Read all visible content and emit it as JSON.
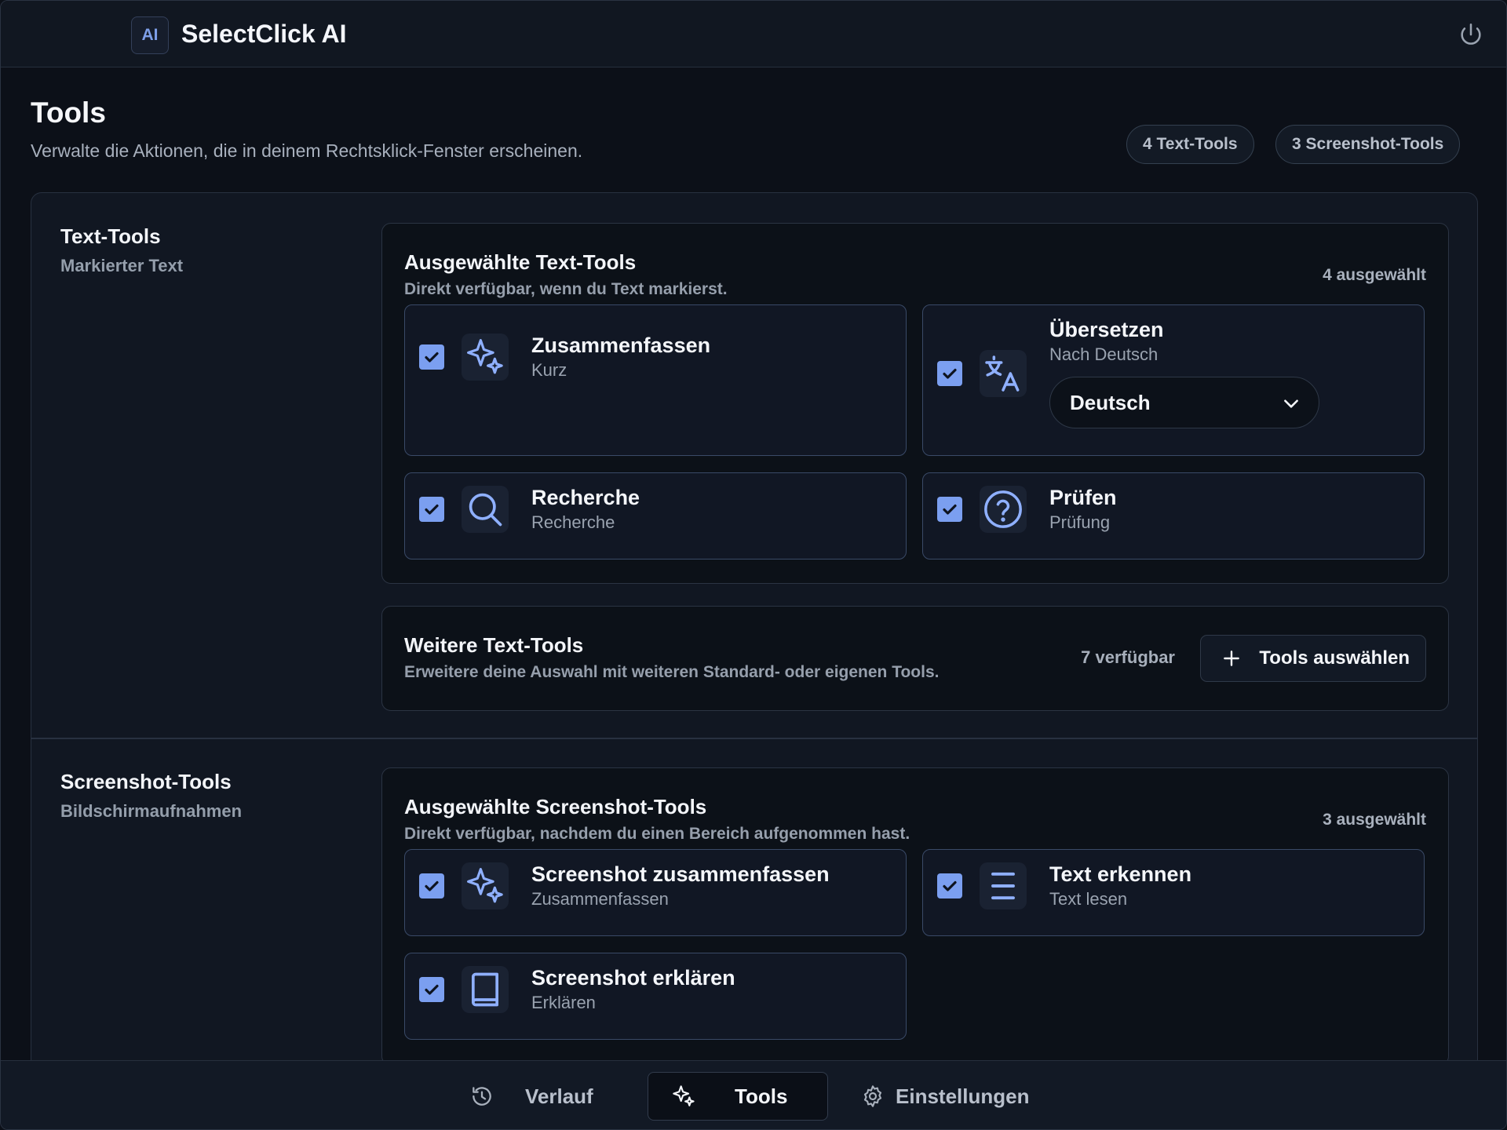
{
  "app": {
    "logo": "AI",
    "title": "SelectClick AI",
    "power_icon": "power-icon"
  },
  "page": {
    "title": "Tools",
    "subtitle": "Verwalte die Aktionen, die in deinem Rechtsklick-Fenster erscheinen.",
    "pills": {
      "text_tools": "4 Text-Tools",
      "screenshot_tools": "3 Screenshot-Tools"
    }
  },
  "text_section": {
    "title": "Text-Tools",
    "subtitle": "Markierter Text",
    "selected": {
      "title": "Ausgewählte Text-Tools",
      "description": "Direkt verfügbar, wenn du Text markierst.",
      "count": "4 ausgewählt",
      "tools": [
        {
          "name": "Zusammenfassen",
          "sub": "Kurz",
          "icon": "sparkles-icon",
          "checked": true
        },
        {
          "name": "Übersetzen",
          "sub": "Nach Deutsch",
          "icon": "translate-icon",
          "checked": true,
          "select_value": "Deutsch"
        },
        {
          "name": "Recherche",
          "sub": "Recherche",
          "icon": "search-icon",
          "checked": true
        },
        {
          "name": "Prüfen",
          "sub": "Prüfung",
          "icon": "question-circle-icon",
          "checked": true
        }
      ]
    },
    "more": {
      "title": "Weitere Text-Tools",
      "description": "Erweitere deine Auswahl mit weiteren Standard- oder eigenen Tools.",
      "available": "7 verfügbar",
      "button": "Tools auswählen"
    }
  },
  "screenshot_section": {
    "title": "Screenshot-Tools",
    "subtitle": "Bildschirmaufnahmen",
    "selected": {
      "title": "Ausgewählte Screenshot-Tools",
      "description": "Direkt verfügbar, nachdem du einen Bereich aufgenommen hast.",
      "count": "3 ausgewählt",
      "tools": [
        {
          "name": "Screenshot zusammenfassen",
          "sub": "Zusammenfassen",
          "icon": "sparkles-icon",
          "checked": true
        },
        {
          "name": "Text erkennen",
          "sub": "Text lesen",
          "icon": "lines-icon",
          "checked": true
        },
        {
          "name": "Screenshot erklären",
          "sub": "Erklären",
          "icon": "book-icon",
          "checked": true
        }
      ]
    }
  },
  "nav": {
    "items": [
      {
        "label": "Verlauf",
        "icon": "history-icon"
      },
      {
        "label": "Tools",
        "icon": "sparkles-icon",
        "active": true
      },
      {
        "label": "Einstellungen",
        "icon": "gear-icon"
      }
    ]
  },
  "colors": {
    "accent": "#7b9ff0",
    "background": "#0c1018",
    "card": "#111724",
    "border": "#3a4a67"
  }
}
